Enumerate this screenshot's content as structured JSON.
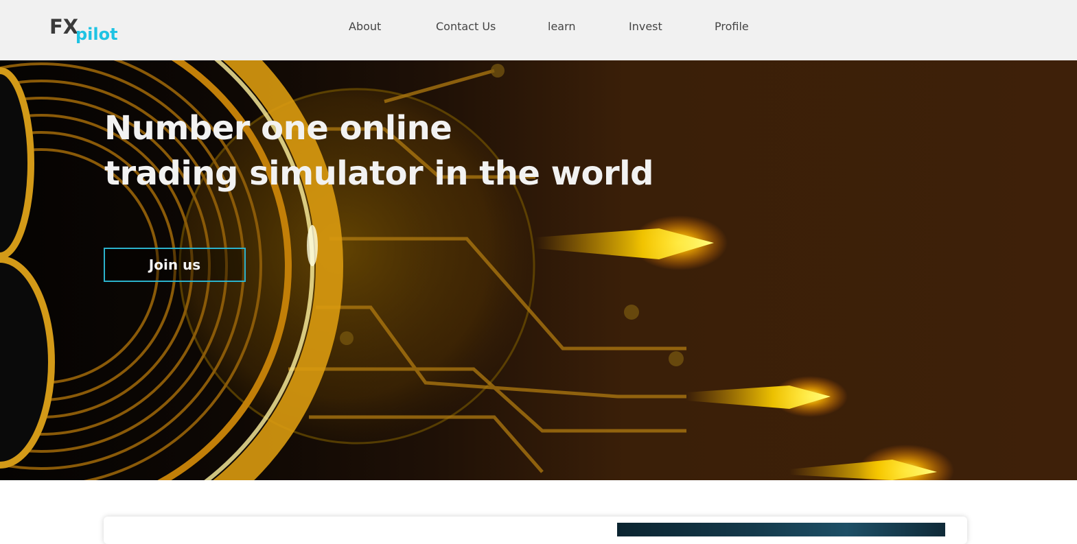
{
  "brand": {
    "primary": "FX",
    "secondary": "pilot",
    "accent_color": "#1fc3e3"
  },
  "nav": {
    "items": [
      {
        "label": "About"
      },
      {
        "label": "Contact Us"
      },
      {
        "label": "learn"
      },
      {
        "label": "Invest"
      },
      {
        "label": "Profile"
      }
    ]
  },
  "hero": {
    "title_line1": "Number one online",
    "title_line2": "trading simulator in the world",
    "cta_label": "Join us",
    "cta_border_color": "#2bb2cc"
  }
}
